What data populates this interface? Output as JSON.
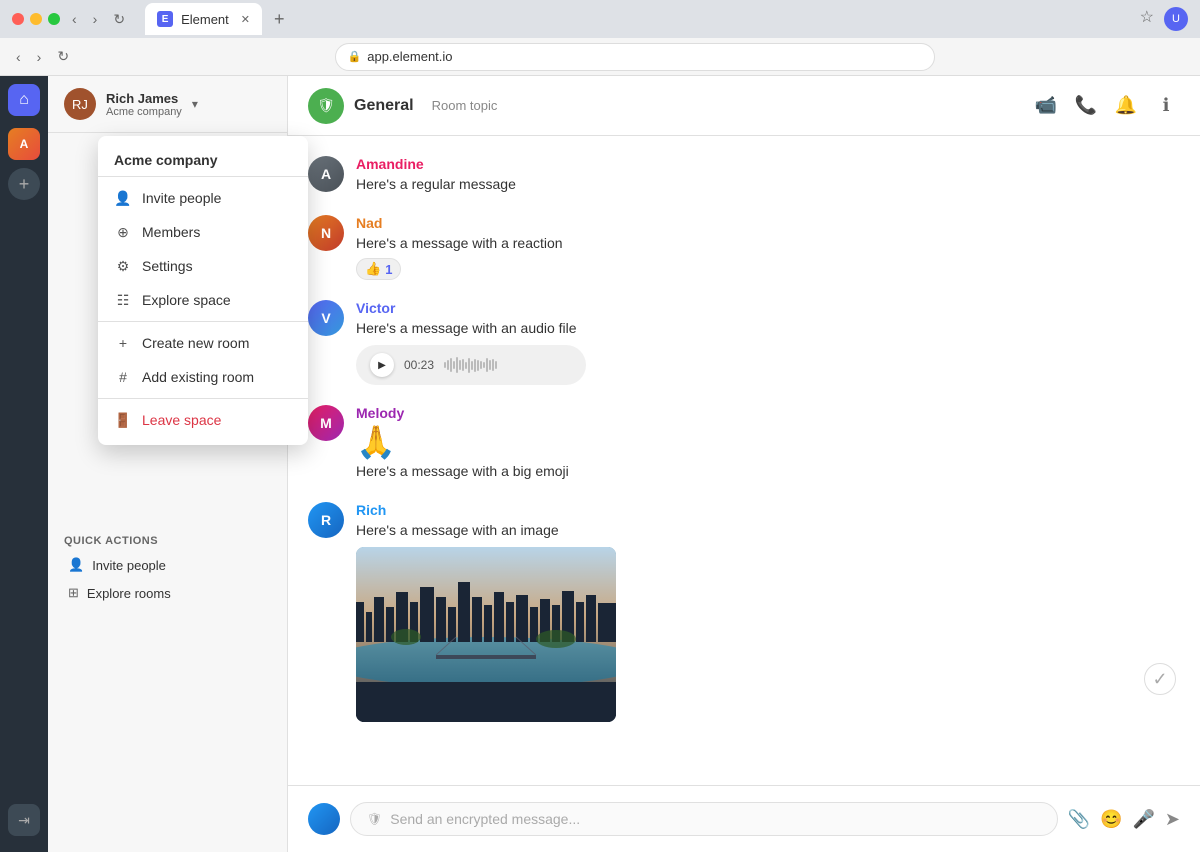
{
  "browser": {
    "url": "app.element.io",
    "tab_title": "Element",
    "tab_favicon": "E",
    "new_tab_label": "+"
  },
  "sidebar": {
    "user": {
      "name": "Rich James",
      "org": "Acme company",
      "avatar_initials": "RJ"
    },
    "space_menu": {
      "title": "Acme company",
      "items": [
        {
          "id": "invite-people",
          "icon": "👤",
          "label": "Invite people"
        },
        {
          "id": "members",
          "icon": "⊕",
          "label": "Members"
        },
        {
          "id": "settings",
          "icon": "⚙",
          "label": "Settings"
        },
        {
          "id": "explore-space",
          "icon": "☷",
          "label": "Explore space"
        },
        {
          "id": "create-new-room",
          "icon": "+",
          "label": "Create new room"
        },
        {
          "id": "add-existing-room",
          "icon": "#",
          "label": "Add existing room"
        },
        {
          "id": "leave-space",
          "icon": "🚪",
          "label": "Leave space",
          "danger": true
        }
      ]
    },
    "quick_actions_title": "Quick actions",
    "quick_actions": [
      {
        "id": "invite-people-action",
        "icon": "👤",
        "label": "Invite people"
      },
      {
        "id": "explore-rooms-action",
        "icon": "⊞",
        "label": "Explore rooms"
      }
    ]
  },
  "chat": {
    "room_name": "General",
    "room_topic": "Room topic",
    "header_actions": [
      "video",
      "call",
      "notifications",
      "info"
    ],
    "messages": [
      {
        "id": "msg1",
        "sender": "Amandine",
        "sender_color": "amandine",
        "avatar_initials": "A",
        "text": "Here's a regular message",
        "type": "text"
      },
      {
        "id": "msg2",
        "sender": "Nad",
        "sender_color": "nad",
        "avatar_initials": "N",
        "text": "Here's a message with a reaction",
        "type": "text",
        "reaction": "👍",
        "reaction_count": "1"
      },
      {
        "id": "msg3",
        "sender": "Victor",
        "sender_color": "victor",
        "avatar_initials": "V",
        "text": "Here's a message with an audio file",
        "type": "audio",
        "audio_time": "00:23"
      },
      {
        "id": "msg4",
        "sender": "Melody",
        "sender_color": "melody",
        "avatar_initials": "M",
        "text": "Here's a message with a big emoji",
        "type": "emoji",
        "emoji": "🙏"
      },
      {
        "id": "msg5",
        "sender": "Rich",
        "sender_color": "rich",
        "avatar_initials": "R",
        "text": "Here's a message with an image",
        "type": "image"
      }
    ],
    "input_placeholder": "Send an encrypted message..."
  }
}
